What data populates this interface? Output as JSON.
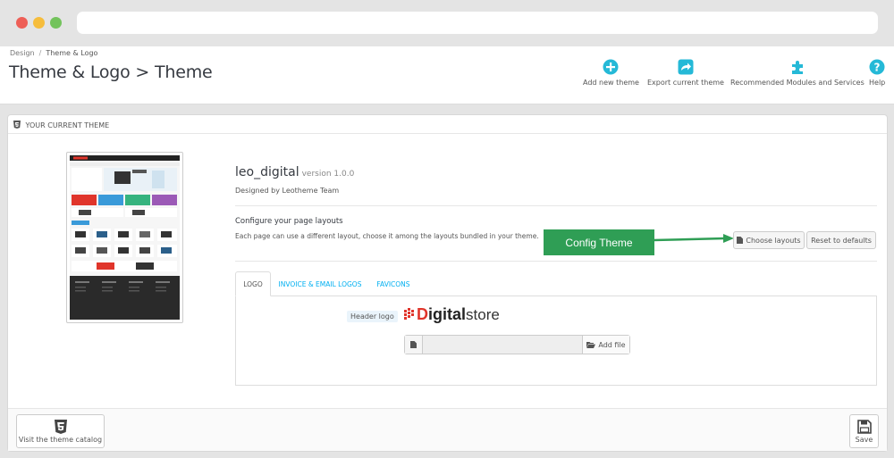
{
  "breadcrumb": {
    "parent": "Design",
    "separator": "/",
    "current": "Theme & Logo"
  },
  "page": {
    "title": "Theme & Logo > Theme"
  },
  "toolbar": {
    "add_new_theme": "Add new theme",
    "export_current_theme": "Export current theme",
    "recommended": "Recommended Modules and Services",
    "help": "Help",
    "accent_color": "#25b9d7"
  },
  "panel": {
    "heading": "YOUR CURRENT THEME",
    "theme_name": "leo_digital",
    "theme_version": "version 1.0.0",
    "designed_by": "Designed by Leotheme Team",
    "layouts_title": "Configure your page layouts",
    "layouts_desc": "Each page can use a different layout, choose it among the layouts bundled in your theme.",
    "choose_layouts": "Choose layouts",
    "reset_defaults": "Reset to defaults",
    "callout": "Config Theme",
    "callout_color": "#2f9e55"
  },
  "tabs": [
    {
      "label": "LOGO",
      "active": true
    },
    {
      "label": "INVOICE & EMAIL LOGOS",
      "active": false
    },
    {
      "label": "FAVICONS",
      "active": false
    }
  ],
  "logo_tab": {
    "header_logo_label": "Header logo",
    "logo_text_bold": "igital",
    "logo_text_d": "D",
    "logo_text_store": "store",
    "add_file": "Add file"
  },
  "footer": {
    "visit_catalog": "Visit the theme catalog",
    "save": "Save"
  }
}
